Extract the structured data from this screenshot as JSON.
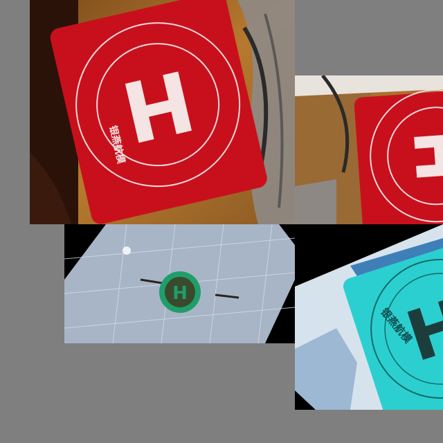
{
  "collage": {
    "background": "#7f7f7f",
    "tiles": [
      {
        "name": "red-landing-pad-photo",
        "pad_color": "#c8101c",
        "letter": "H",
        "brand_text": "银燕航模"
      },
      {
        "name": "red-landing-pad-crop",
        "pad_color": "#c8101c",
        "letter": "H"
      },
      {
        "name": "aerial-landing-pad-on-grid",
        "pad_color": "#1f9e6a",
        "letter": "H"
      },
      {
        "name": "cyan-landing-pad-photo",
        "pad_color": "#2ccfcf",
        "letter": "H",
        "brand_text": "银燕航模"
      }
    ]
  }
}
